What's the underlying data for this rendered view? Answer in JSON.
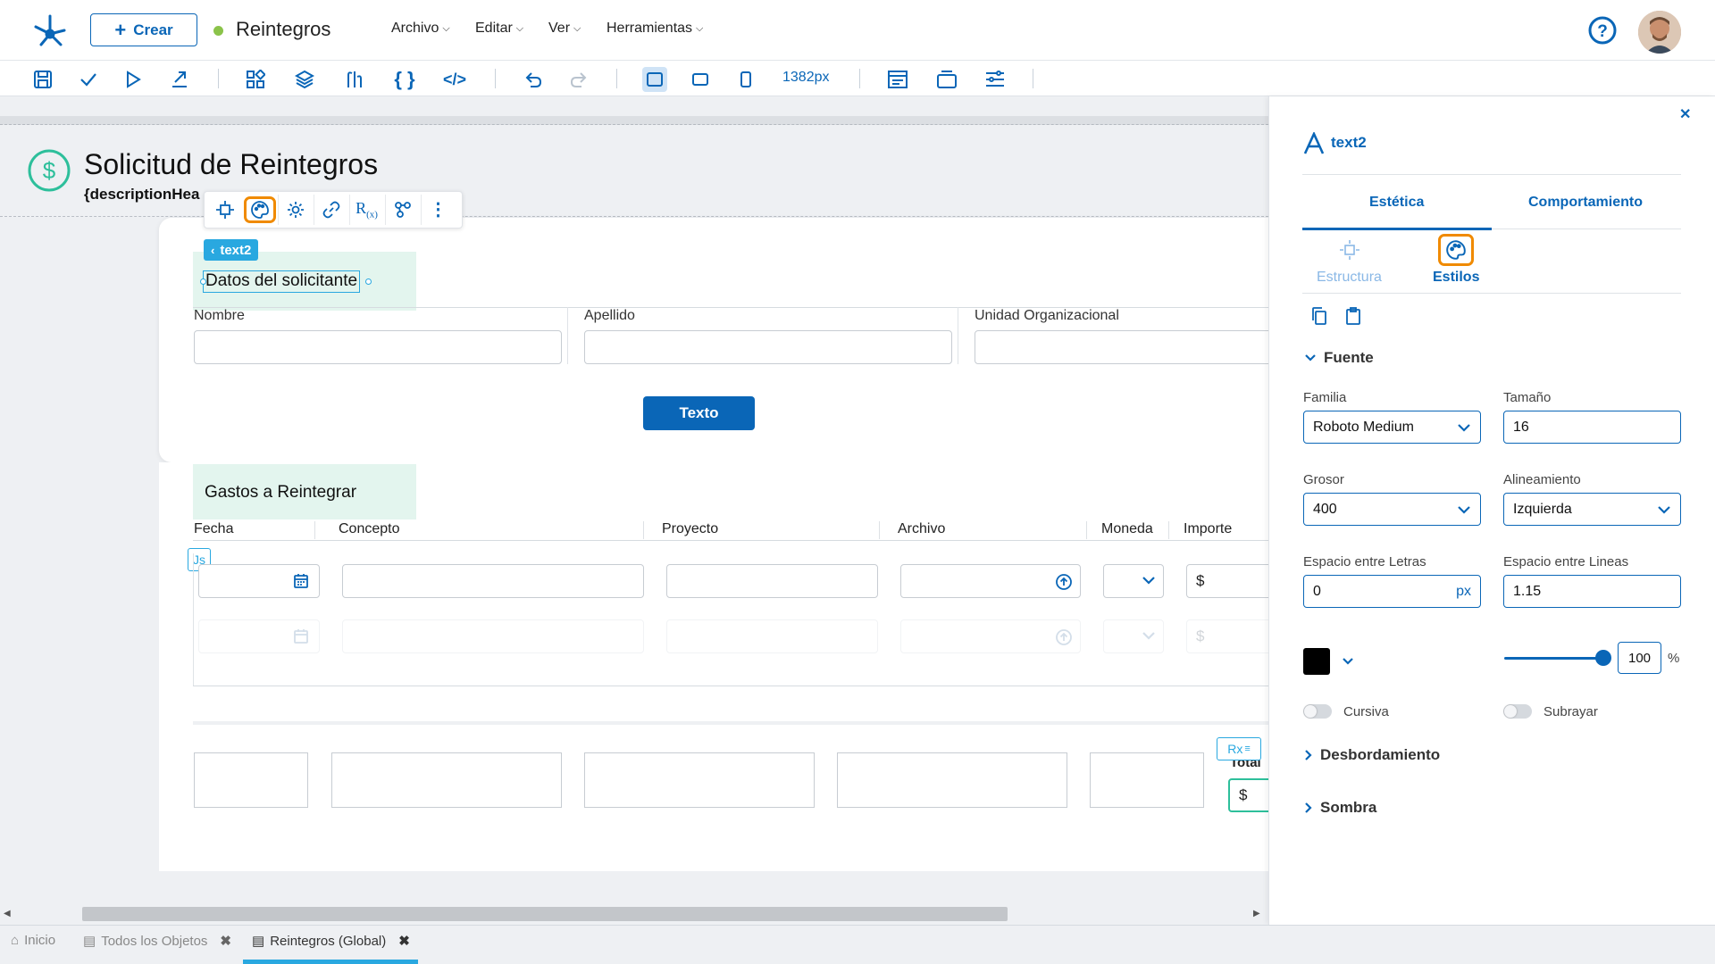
{
  "header": {
    "create_label": "Crear",
    "app_title": "Reintegros",
    "menus": [
      "Archivo",
      "Editar",
      "Ver",
      "Herramientas"
    ]
  },
  "toolbar": {
    "width_label": "1382px"
  },
  "form": {
    "title": "Solicitud de Reintegros",
    "subtitle": "{descriptionHea",
    "selected_badge": "text2",
    "section1_title": "Datos del solicitante",
    "fields": [
      "Nombre",
      "Apellido",
      "Unidad Organizacional"
    ],
    "texto_button": "Texto",
    "section2_title": "Gastos a Reintegrar",
    "columns": [
      "Fecha",
      "Concepto",
      "Proyecto",
      "Archivo",
      "Moneda",
      "Importe"
    ],
    "js_badge": "Js",
    "currency_symbol": "$",
    "rx_badge": "Rx",
    "total_label": "Total"
  },
  "panel": {
    "element_name": "text2",
    "tabs": [
      "Estética",
      "Comportamiento"
    ],
    "subtabs": [
      "Estructura",
      "Estilos"
    ],
    "font_section": "Fuente",
    "familia_label": "Familia",
    "familia_value": "Roboto Medium",
    "tamano_label": "Tamaño",
    "tamano_value": "16",
    "grosor_label": "Grosor",
    "grosor_value": "400",
    "alineamiento_label": "Alineamiento",
    "alineamiento_value": "Izquierda",
    "letras_label": "Espacio entre Letras",
    "letras_value": "0",
    "letras_unit": "px",
    "lineas_label": "Espacio entre Lineas",
    "lineas_value": "1.15",
    "color_value": "#000000",
    "opacity_value": "100",
    "opacity_unit": "%",
    "cursiva_label": "Cursiva",
    "subrayar_label": "Subrayar",
    "overflow_section": "Desbordamiento",
    "shadow_section": "Sombra"
  },
  "statusbar": {
    "tabs": [
      "Inicio",
      "Todos los Objetos",
      "Reintegros (Global)"
    ]
  },
  "colors": {
    "accent": "#0a66b7",
    "selection": "#29a8e0",
    "highlight": "#f08a00",
    "success": "#2dbf9b"
  }
}
